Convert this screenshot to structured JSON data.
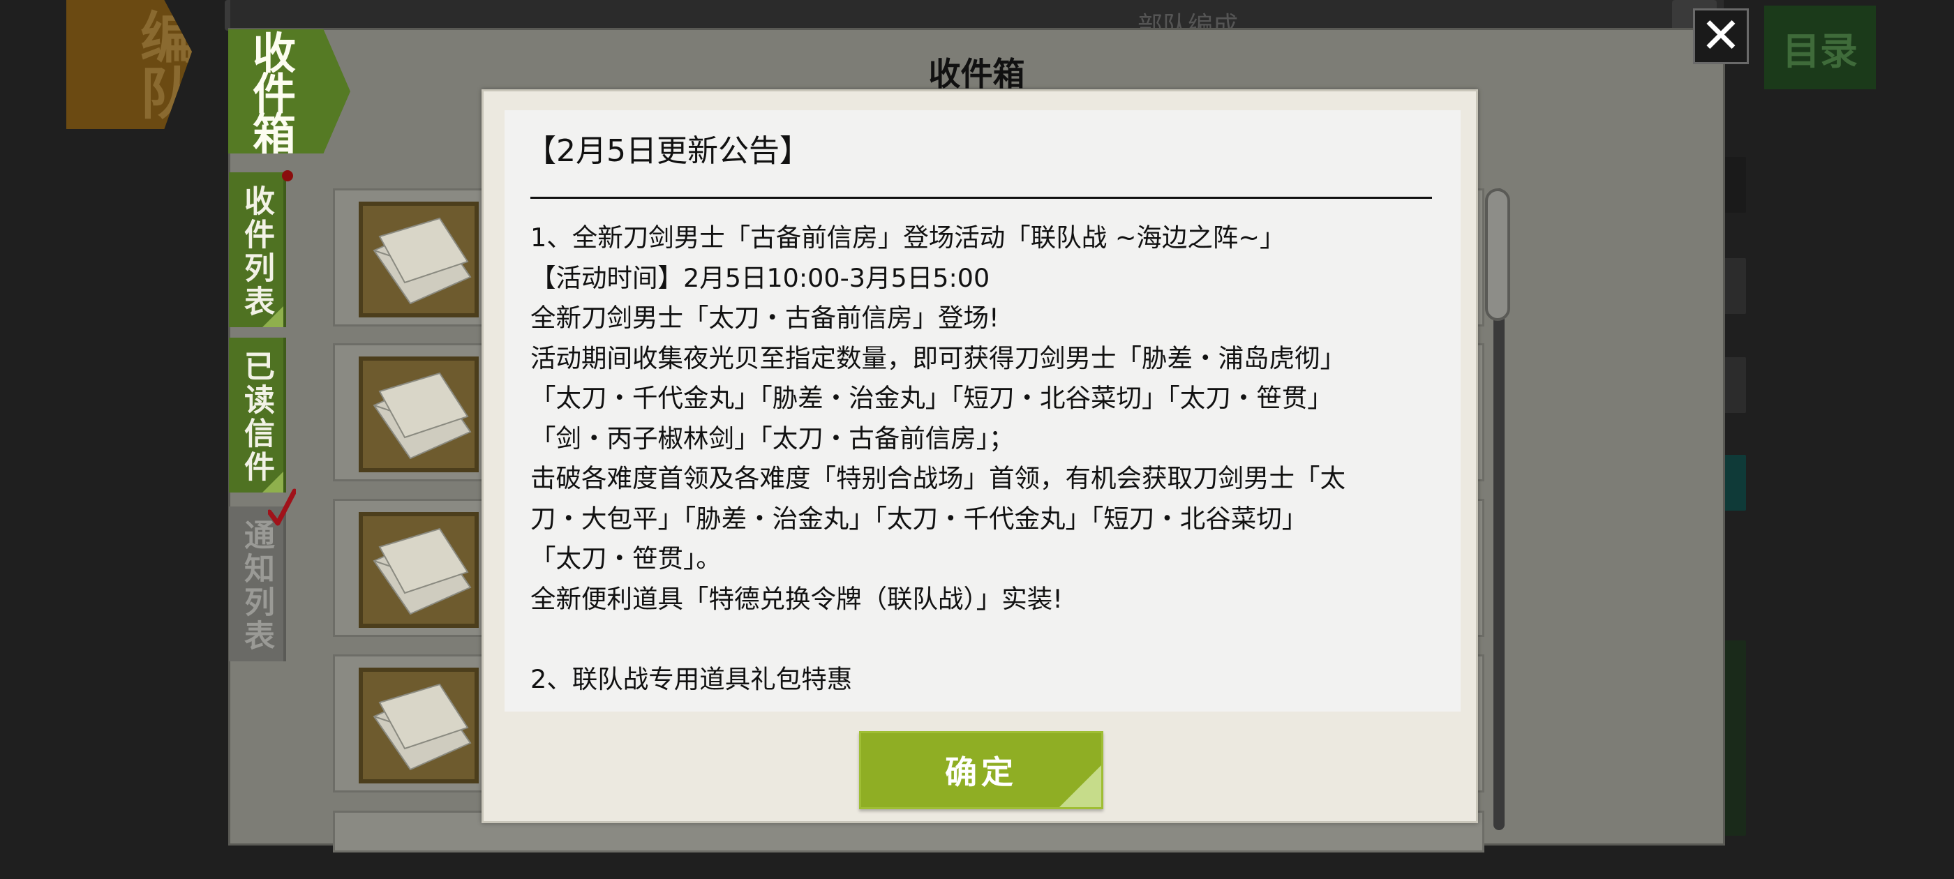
{
  "background": {
    "formation_tab": "编队",
    "topbar_text": "部队编成",
    "catalog_button": "目录"
  },
  "mailbox": {
    "title": "收件箱",
    "banner": "收件箱",
    "tabs": [
      {
        "label": "收件列表",
        "active": true,
        "has_unread_dot": true
      },
      {
        "label": "已读信件",
        "active": true
      },
      {
        "label": "通知列表",
        "active": false,
        "checked": true
      }
    ],
    "close_icon": "close-icon",
    "mail_rows": 4
  },
  "notice": {
    "title": "【2月5日更新公告】",
    "lines": [
      "1、全新刀剑男士「古备前信房」登场活动「联队战 ~海边之阵~」",
      "【活动时间】2月5日10:00-3月5日5:00",
      "全新刀剑男士「太刀・古备前信房」登场!",
      "活动期间收集夜光贝至指定数量，即可获得刀剑男士「胁差・浦岛虎彻」",
      "「太刀・千代金丸」「胁差・治金丸」「短刀・北谷菜切」「太刀・笹贯」",
      "「剑・丙子椒林剑」「太刀・古备前信房」；",
      "击破各难度首领及各难度「特别合战场」首领，有机会获取刀剑男士「太",
      "刀・大包平」「胁差・治金丸」「太刀・千代金丸」「短刀・北谷菜切」",
      "「太刀・笹贯」。",
      "全新便利道具「特德兑换令牌（联队战）」实装!",
      "",
      "2、联队战专用道具礼包特惠"
    ],
    "ok_button": "确定"
  },
  "colors": {
    "accent_green": "#8fae24",
    "tab_green": "#4f7222",
    "dialog_bg": "#ece9e0"
  }
}
